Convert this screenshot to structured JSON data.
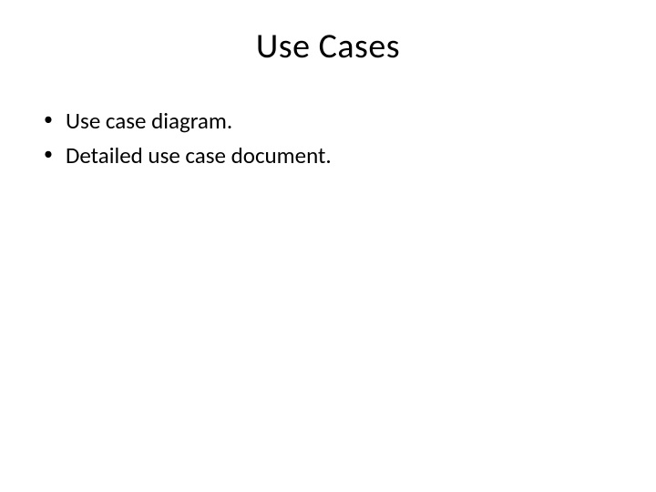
{
  "slide": {
    "title": "Use Cases",
    "bullets": [
      {
        "text": "Use case diagram."
      },
      {
        "text": "Detailed use case document."
      }
    ]
  }
}
